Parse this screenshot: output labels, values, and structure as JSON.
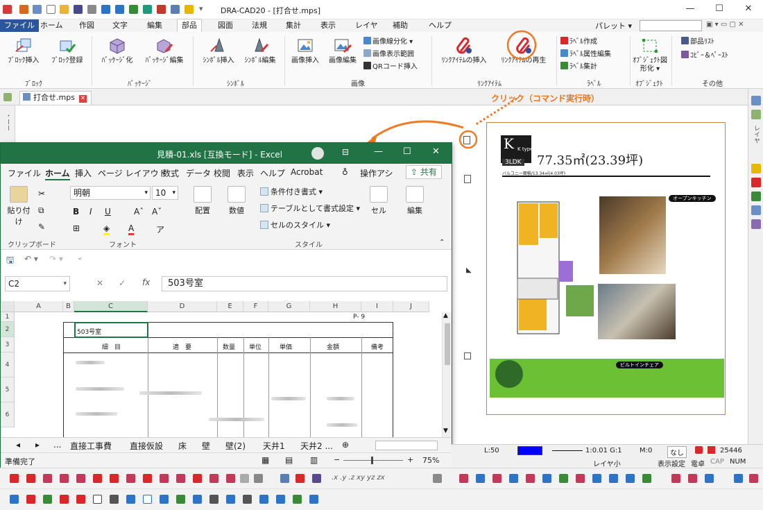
{
  "window": {
    "title": "DRA-CAD20 - [打合せ.mps]"
  },
  "menu": {
    "tabs": [
      "ファイル",
      "ホーム",
      "作図",
      "文字",
      "編集",
      "部品",
      "図面",
      "法規",
      "集計",
      "表示",
      "レイヤ",
      "補助",
      "ヘルプ"
    ],
    "palette": "パレット ▾"
  },
  "ribbon": {
    "block_insert": "ﾌﾞﾛｯｸ挿入",
    "block_register": "ﾌﾞﾛｯｸ登録",
    "package_create": "ﾊﾟｯｹｰｼﾞ化",
    "package_edit": "ﾊﾟｯｹｰｼﾞ編集",
    "symbol_insert": "ｼﾝﾎﾞﾙ挿入",
    "symbol_edit": "ｼﾝﾎﾞﾙ編集",
    "image_insert": "画像挿入",
    "image_edit": "画像編集",
    "image_line": "画像線分化 ▾",
    "image_range": "画像表示範囲",
    "qr_insert": "QRコード挿入",
    "link_insert": "ﾘﾝｸｱｲﾃﾑの挿入",
    "link_play": "ﾘﾝｸｱｲﾃﾑの再生",
    "label_create": "ﾗﾍﾞﾙ作成",
    "label_attr": "ﾗﾍﾞﾙ属性編集",
    "label_sum": "ﾗﾍﾞﾙ集計",
    "object_shape": "ｵﾌﾞｼﾞｪｸﾄ図形化 ▾",
    "parts_list": "部品ﾘｽﾄ",
    "copy_paste": "ｺﾋﾟｰ＆ﾍﾟｰｽﾄ",
    "groups": [
      "ﾌﾞﾛｯｸ",
      "ﾊﾟｯｹｰｼﾞ",
      "ｼﾝﾎﾞﾙ",
      "画像",
      "ﾘﾝｸｱｲﾃﾑ",
      "ﾗﾍﾞﾙ",
      "ｵﾌﾞｼﾞｪｸﾄ",
      "その他"
    ]
  },
  "document": {
    "tab": "打合せ.mps"
  },
  "annotation": {
    "callout": "クリック（コマンド実行時）"
  },
  "excel": {
    "title": "見積-01.xls [互換モード] - Excel",
    "menus": [
      "ファイル",
      "ホーム",
      "挿入",
      "ページ レイアウト",
      "数式",
      "データ",
      "校閲",
      "表示",
      "ヘルプ",
      "Acrobat",
      "操作アシ",
      "共有"
    ],
    "font_name": "明朝",
    "font_size": "10",
    "ribbon": {
      "paste": "貼り付け",
      "align": "配置",
      "number": "数値",
      "cond_format": "条件付き書式 ▾",
      "table_format": "テーブルとして書式設定 ▾",
      "cell_style": "セルのスタイル ▾",
      "cells": "セル",
      "editing": "編集",
      "group_clipboard": "クリップボード",
      "group_font": "フォント",
      "group_style": "スタイル"
    },
    "name_box": "C2",
    "formula_value": "503号室",
    "columns": [
      "A",
      "B",
      "C",
      "D",
      "E",
      "F",
      "G",
      "H",
      "I",
      "J"
    ],
    "rows": [
      "1",
      "2",
      "3",
      "4",
      "5",
      "6"
    ],
    "page_label": "P- 9",
    "room": "503号室",
    "table_headers": [
      "細　目",
      "適　要",
      "数量",
      "単位",
      "単価",
      "金額",
      "備考"
    ],
    "sheet_tabs": [
      "...",
      "直接工事費",
      "直接仮設",
      "床",
      "壁",
      "壁(2)",
      "天井1",
      "天井2 ..."
    ],
    "status": "準備完了",
    "zoom": "75%"
  },
  "cad_status": {
    "scale": "1:0.01 G:1",
    "layer_scale": "L:50",
    "m": "M:0",
    "none": "なし",
    "count": "25446",
    "layer": "レイヤ小",
    "settings": "表示設定",
    "power": "電卓",
    "caps": "CAP",
    "num": "NUM"
  },
  "flyer": {
    "area": "77.35㎡(23.39坪)",
    "type": "3LDK",
    "k_type": "K type",
    "balcony": "バルコニー面積/13.34㎡(4.03坪)",
    "kitchen": "オープンキッチン",
    "garden": "ビルトインチェア"
  }
}
